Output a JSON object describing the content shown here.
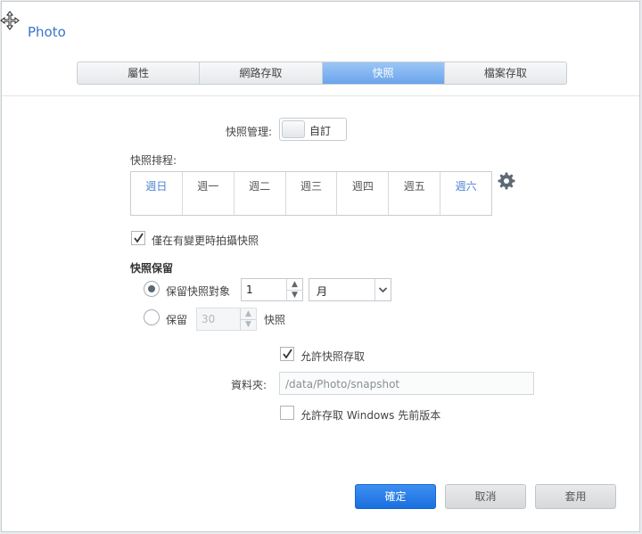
{
  "dialog": {
    "title": "Photo"
  },
  "tabs": [
    {
      "label": "屬性",
      "active": false
    },
    {
      "label": "網路存取",
      "active": false
    },
    {
      "label": "快照",
      "active": true
    },
    {
      "label": "檔案存取",
      "active": false
    }
  ],
  "snapshot_management": {
    "label": "快照管理:",
    "toggle_label": "自訂",
    "enabled": false
  },
  "schedule": {
    "label": "快照排程:",
    "days": [
      "週日",
      "週一",
      "週二",
      "週三",
      "週四",
      "週五",
      "週六"
    ],
    "settings_icon": "gear-icon"
  },
  "only_on_change": {
    "label": "僅在有變更時拍攝快照",
    "checked": true
  },
  "retention": {
    "title": "快照保留",
    "option_keep_for": {
      "label": "保留快照對象",
      "checked": true,
      "value": "1",
      "unit": "月"
    },
    "option_keep_count": {
      "label": "保留",
      "checked": false,
      "value": "30",
      "suffix": "快照"
    }
  },
  "allow_access": {
    "label": "允許快照存取",
    "checked": true
  },
  "folder": {
    "label": "資料夾:",
    "value": "/data/Photo/snapshot"
  },
  "windows_previous": {
    "label": "允許存取 Windows 先前版本",
    "checked": false
  },
  "buttons": {
    "ok": "確定",
    "cancel": "取消",
    "apply": "套用"
  },
  "colors": {
    "accent": "#3a73c9",
    "primary_button": "#1a70e0",
    "tab_active": "#6aa4ec"
  }
}
